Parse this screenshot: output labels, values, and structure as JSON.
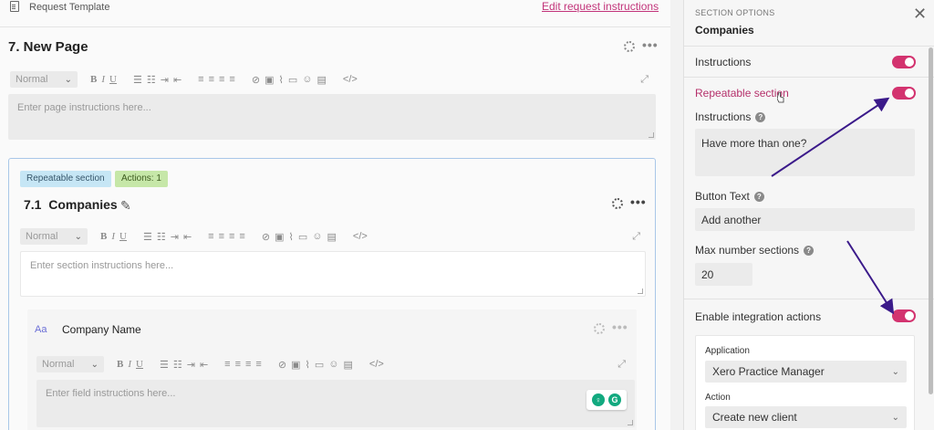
{
  "topbar": {
    "template_label": "Request Template",
    "edit_link": "Edit request instructions"
  },
  "page": {
    "title": "7. New Page",
    "placeholder": "Enter page instructions here..."
  },
  "toolbar": {
    "style": "Normal",
    "bold": "B",
    "italic": "I",
    "underline": "U",
    "code": "</>"
  },
  "section": {
    "badge_repeatable": "Repeatable section",
    "badge_actions": "Actions: 1",
    "title": "7.1  Companies",
    "placeholder": "Enter section instructions here..."
  },
  "field": {
    "type_icon": "Aa",
    "name": "Company Name",
    "placeholder": "Enter field instructions here..."
  },
  "options": {
    "caption": "SECTION OPTIONS",
    "title": "Companies",
    "instructions_label": "Instructions",
    "repeatable_label": "Repeatable section",
    "instructions_sub_label": "Instructions",
    "instructions_value": "Have more than one?",
    "button_text_label": "Button Text",
    "button_text_value": "Add another",
    "max_sections_label": "Max number sections",
    "max_sections_value": "20",
    "integration_label": "Enable integration actions",
    "application_label": "Application",
    "application_value": "Xero Practice Manager",
    "action_label": "Action",
    "action_value": "Create new client"
  },
  "colors": {
    "accent": "#d3336f",
    "link": "#c2347a",
    "arrow": "#3b1a8a"
  }
}
